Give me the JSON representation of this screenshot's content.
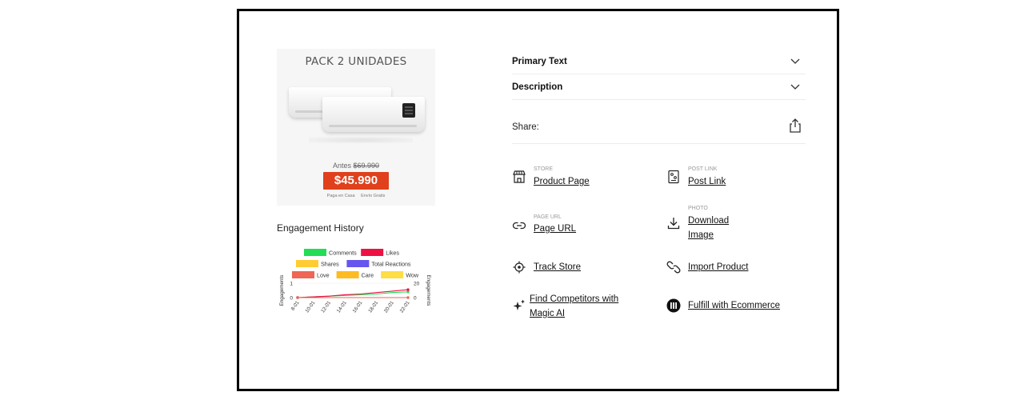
{
  "product_image": {
    "title": "PACK 2 UNIDADES",
    "old_price_prefix": "Antes",
    "old_price": "$69.990",
    "price": "$45.990",
    "badge_pay": "Paga en Casa",
    "badge_ship": "Envío Gratis"
  },
  "engagement": {
    "title": "Engagement History",
    "legend": [
      "Comments",
      "Likes",
      "Shares",
      "Total Reactions",
      "Love",
      "Care",
      "Wow"
    ]
  },
  "chart_data": {
    "type": "line",
    "title": "Engagement History",
    "x": [
      "8-01",
      "10-01",
      "12-01",
      "14-01",
      "16-01",
      "18-01",
      "20-01",
      "22-01"
    ],
    "ylabel": "Engagements",
    "y2label": "Engagements",
    "ylim": [
      0,
      1
    ],
    "y2lim": [
      0,
      20
    ],
    "left_ticks": [
      "0",
      "1"
    ],
    "right_ticks": [
      "0",
      "20"
    ],
    "legend": [
      "Comments",
      "Likes",
      "Shares",
      "Total Reactions",
      "Love",
      "Care",
      "Wow"
    ],
    "colors": {
      "Comments": "#22dd55",
      "Likes": "#ee1144",
      "Shares": "#ffcc33",
      "Total Reactions": "#6655ee",
      "Love": "#ee6655",
      "Care": "#ffbb22",
      "Wow": "#ffdd44"
    },
    "series": [
      {
        "name": "Comments",
        "axis": "right",
        "values": [
          0,
          1,
          2,
          3,
          4,
          5,
          7,
          8
        ]
      },
      {
        "name": "Likes",
        "axis": "right",
        "values": [
          0,
          1,
          2,
          4,
          5,
          7,
          9,
          11
        ]
      },
      {
        "name": "Love",
        "axis": "right",
        "values": [
          0,
          0,
          0,
          0,
          0,
          0,
          0,
          0
        ]
      }
    ]
  },
  "accordion": {
    "primary_text": "Primary Text",
    "description": "Description"
  },
  "share": {
    "label": "Share:"
  },
  "actions": {
    "store_caption": "STORE",
    "product_page": "Product Page",
    "post_link_caption": "POST LINK",
    "post_link": "Post Link",
    "page_url_caption": "PAGE URL",
    "page_url": "Page URL",
    "photo_caption": "PHOTO",
    "download": "Download",
    "image": "Image",
    "track_store": "Track Store",
    "import_product": "Import Product",
    "find_competitors_1": "Find Competitors with",
    "find_competitors_2": "Magic AI",
    "fulfill": "Fulfill with Ecommerce"
  },
  "icons": [
    "chevron-down-icon",
    "share-icon",
    "store-icon",
    "post-link-icon",
    "link-icon",
    "download-icon",
    "target-icon",
    "import-link-icon",
    "sparkle-icon",
    "ecommerce-logo-icon"
  ]
}
